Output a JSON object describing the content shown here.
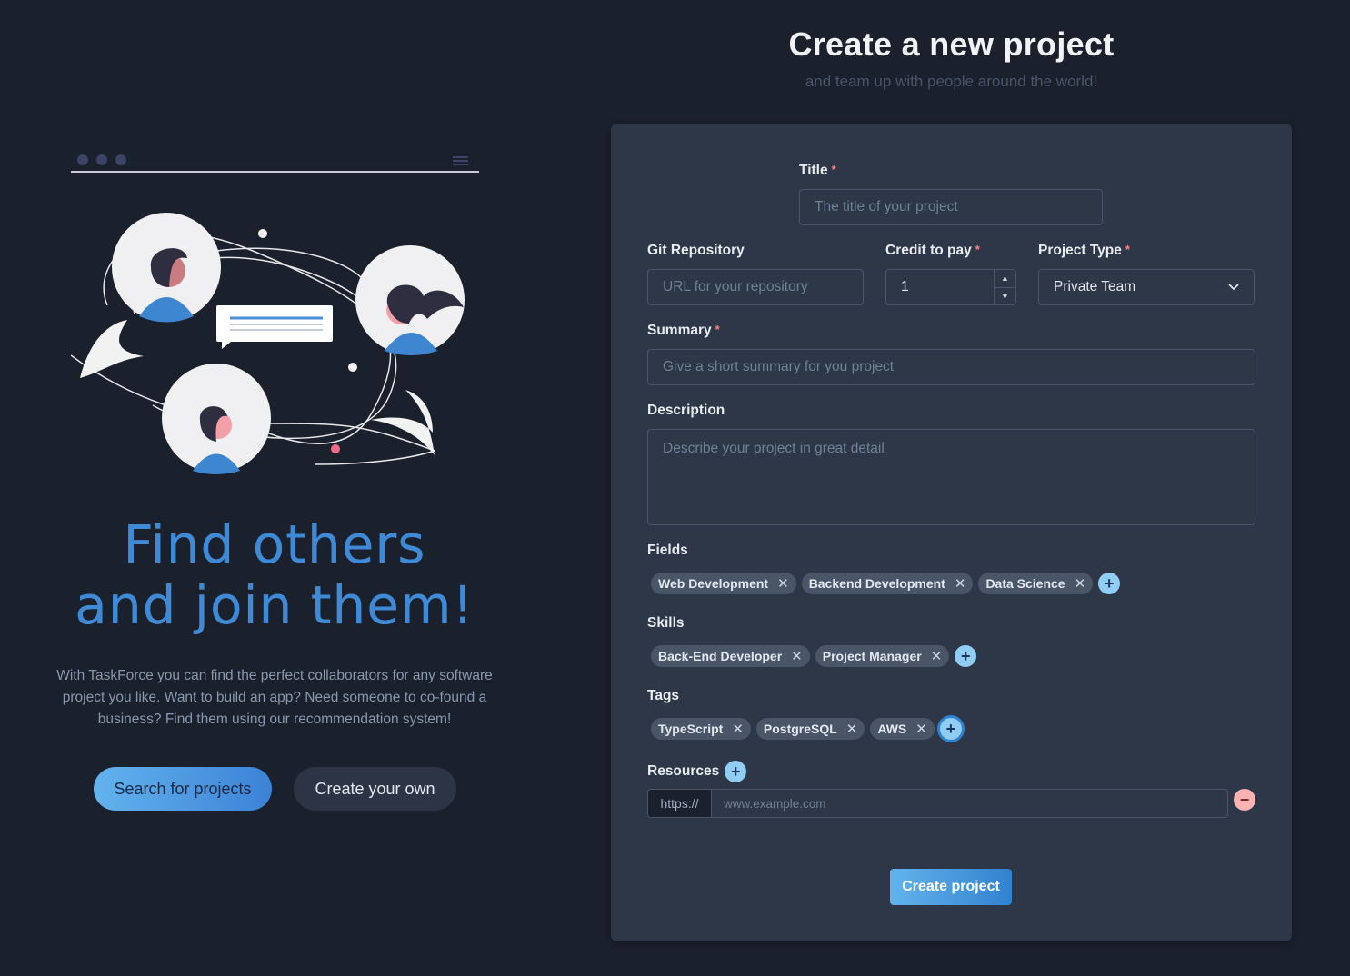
{
  "left": {
    "title_line1": "Find others",
    "title_line2": "and join them!",
    "description": "With TaskForce you can find the perfect collaborators for any software project you like. Want to build an app? Need someone to co-found a business? Find them using our recommendation system!",
    "search_button": "Search for projects",
    "create_button": "Create your own"
  },
  "header": {
    "title": "Create a new project",
    "subtitle": "and team up with people around the world!"
  },
  "form": {
    "title": {
      "label": "Title",
      "required": "*",
      "placeholder": "The title of your project"
    },
    "git": {
      "label": "Git Repository",
      "placeholder": "URL for your repository"
    },
    "credit": {
      "label": "Credit to pay",
      "required": "*",
      "value": "1"
    },
    "project_type": {
      "label": "Project Type",
      "required": "*",
      "value": "Private Team"
    },
    "summary": {
      "label": "Summary",
      "required": "*",
      "placeholder": "Give a short summary for you project"
    },
    "description": {
      "label": "Description",
      "placeholder": "Describe your project in great detail"
    },
    "fields": {
      "label": "Fields",
      "items": [
        "Web Development",
        "Backend Development",
        "Data Science"
      ]
    },
    "skills": {
      "label": "Skills",
      "items": [
        "Back-End Developer",
        "Project Manager"
      ]
    },
    "tags": {
      "label": "Tags",
      "items": [
        "TypeScript",
        "PostgreSQL",
        "AWS"
      ]
    },
    "resources": {
      "label": "Resources",
      "prefix": "https://",
      "placeholder": "www.example.com"
    },
    "submit": "Create project"
  },
  "colors": {
    "background": "#1a202c",
    "card": "#2d3748",
    "accent": "#63b3ed",
    "required": "#fc8181"
  }
}
